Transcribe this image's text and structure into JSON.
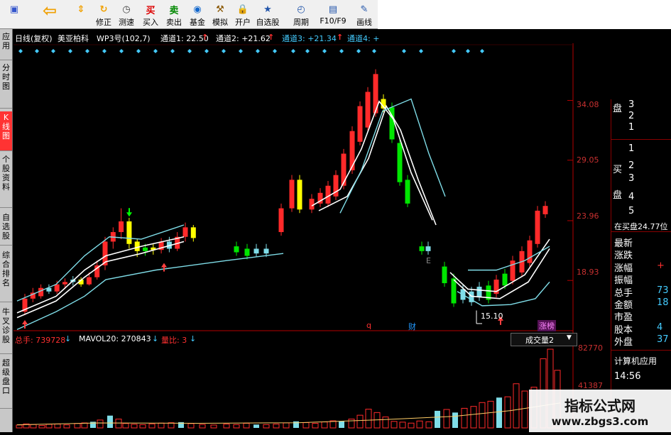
{
  "toolbar": {
    "buttons": [
      {
        "label": "",
        "icon": "app-icon",
        "color": "#3355cc"
      },
      {
        "label": "",
        "icon": "back-arrow-icon",
        "color": "#f0a000"
      },
      {
        "label": "",
        "icon": "arrows-updown-icon",
        "color": "#f0a000"
      },
      {
        "label": "修正",
        "icon": "refresh-icon",
        "color": "#f0a000"
      },
      {
        "label": "测速",
        "icon": "clock-icon",
        "color": "#444444"
      },
      {
        "label": "买入",
        "icon": "buy-icon",
        "color": "#dd0000",
        "glyph": "买"
      },
      {
        "label": "卖出",
        "icon": "sell-icon",
        "color": "#008800",
        "glyph": "卖"
      },
      {
        "label": "基金",
        "icon": "fund-icon",
        "color": "#1166cc"
      },
      {
        "label": "模拟",
        "icon": "hammer-icon",
        "color": "#885500"
      },
      {
        "label": "开户",
        "icon": "lock-icon",
        "color": "#cc8800"
      },
      {
        "label": "自选股",
        "icon": "star-icon",
        "color": "#2255aa"
      },
      {
        "label": "周期",
        "icon": "cycle-icon",
        "color": "#2255aa"
      },
      {
        "label": "F10/F9",
        "icon": "f10-icon",
        "color": "#2255aa"
      },
      {
        "label": "画线",
        "icon": "pen-icon",
        "color": "#2255aa"
      }
    ]
  },
  "left_tabs": [
    {
      "label": "应用",
      "active": false
    },
    {
      "label": "分时图",
      "active": false
    },
    {
      "label": "K线图",
      "active": true
    },
    {
      "label": "个股资料",
      "active": false
    },
    {
      "label": "自选股",
      "active": false
    },
    {
      "label": "综合排名",
      "active": false
    },
    {
      "label": "牛叉诊股",
      "active": false
    },
    {
      "label": "超级盘口",
      "active": false
    }
  ],
  "header": {
    "title": "日线(复权)",
    "stock_name": "美亚柏科",
    "indicator": "WP3号(102,7)",
    "ch1": "通道1: 22.50",
    "ch2": "通道2: +21.62",
    "ch3": "通道3: +21.34",
    "ch4": "通道4: +"
  },
  "price_axis": {
    "labels": [
      "34.08",
      "29.05",
      "23.96",
      "18.93"
    ]
  },
  "annotations": {
    "low_label": "15.10",
    "q_mark": "q",
    "cai_mark": "财",
    "zhang_mark": "涨榜",
    "e_mark": "E"
  },
  "volume": {
    "zongshou": "总手: 739728",
    "mavol": "MAVOL20: 270843",
    "liangbi": "量比: 3",
    "dropdown": "成交量2",
    "axis_labels": [
      "82770",
      "41387"
    ]
  },
  "right_panel": {
    "pan_sell": "盘",
    "pan_buy": "盘",
    "mai_label": "买",
    "sell_levels": [
      "3",
      "2",
      "1"
    ],
    "buy_levels": [
      "1",
      "2",
      "3",
      "4",
      "5"
    ],
    "buy_info": "在买盘24.77位",
    "rows": [
      {
        "label": "最新",
        "value": ""
      },
      {
        "label": "涨跌",
        "value": ""
      },
      {
        "label": "涨幅",
        "value": "+"
      },
      {
        "label": "振幅",
        "value": ""
      },
      {
        "label": "总手",
        "value": "73"
      },
      {
        "label": "金额",
        "value": "18"
      },
      {
        "label": "市盈",
        "value": ""
      },
      {
        "label": "股本",
        "value": "4"
      },
      {
        "label": "外盘",
        "value": "37"
      }
    ],
    "sector": "计算机应用",
    "time": "14:56"
  },
  "watermark": {
    "title": "指标公式网",
    "url": "www.zbgs3.com"
  },
  "colors": {
    "up": "#ff2a2a",
    "down": "#00e600",
    "yellow": "#ffff00",
    "cyan": "#7fdde8",
    "white": "#ffffff",
    "axis": "#b40000",
    "channel": "#44ccff"
  },
  "chart_data": {
    "type": "candlestick",
    "ylim": [
      15.0,
      36.5
    ],
    "ticks": [
      34.08,
      29.05,
      23.96,
      18.93
    ],
    "candles": [
      {
        "o": 16.3,
        "c": 17.4,
        "h": 17.8,
        "l": 16.0,
        "col": "up"
      },
      {
        "o": 17.4,
        "c": 17.9,
        "h": 18.3,
        "l": 17.1,
        "col": "up"
      },
      {
        "o": 17.6,
        "c": 18.3,
        "h": 18.6,
        "l": 17.4,
        "col": "up"
      },
      {
        "o": 18.3,
        "c": 18.0,
        "h": 18.6,
        "l": 17.8,
        "col": "cyan"
      },
      {
        "o": 18.0,
        "c": 18.6,
        "h": 18.9,
        "l": 17.8,
        "col": "up"
      },
      {
        "o": 18.6,
        "c": 18.8,
        "h": 19.1,
        "l": 18.2,
        "col": "up"
      },
      {
        "o": 18.8,
        "c": 19.0,
        "h": 19.3,
        "l": 18.5,
        "col": "cyan"
      },
      {
        "o": 19.0,
        "c": 18.6,
        "h": 19.2,
        "l": 18.4,
        "col": "yellow"
      },
      {
        "o": 18.6,
        "c": 19.2,
        "h": 19.6,
        "l": 18.5,
        "col": "up"
      },
      {
        "o": 19.2,
        "c": 20.2,
        "h": 20.6,
        "l": 19.0,
        "col": "up"
      },
      {
        "o": 20.2,
        "c": 22.2,
        "h": 22.6,
        "l": 19.8,
        "col": "up"
      },
      {
        "o": 22.2,
        "c": 23.0,
        "h": 23.4,
        "l": 21.6,
        "col": "up"
      },
      {
        "o": 23.0,
        "c": 23.9,
        "h": 25.0,
        "l": 22.4,
        "col": "up"
      },
      {
        "o": 23.9,
        "c": 22.0,
        "h": 24.2,
        "l": 21.6,
        "col": "yellow"
      },
      {
        "o": 22.2,
        "c": 21.4,
        "h": 22.4,
        "l": 20.9,
        "col": "yellow"
      },
      {
        "o": 21.4,
        "c": 21.7,
        "h": 22.0,
        "l": 21.0,
        "col": "down"
      },
      {
        "o": 21.7,
        "c": 21.5,
        "h": 22.0,
        "l": 21.1,
        "col": "yellow"
      },
      {
        "o": 21.5,
        "c": 22.2,
        "h": 22.5,
        "l": 21.2,
        "col": "up"
      },
      {
        "o": 22.2,
        "c": 21.6,
        "h": 22.6,
        "l": 21.3,
        "col": "cyan"
      },
      {
        "o": 21.6,
        "c": 22.6,
        "h": 23.0,
        "l": 21.4,
        "col": "up"
      },
      {
        "o": 22.6,
        "c": 23.4,
        "h": 23.8,
        "l": 22.2,
        "col": "up"
      },
      {
        "o": 23.4,
        "c": 22.5,
        "h": 23.6,
        "l": 22.2,
        "col": "yellow"
      }
    ],
    "volume_ylim": [
      0,
      82770
    ]
  }
}
